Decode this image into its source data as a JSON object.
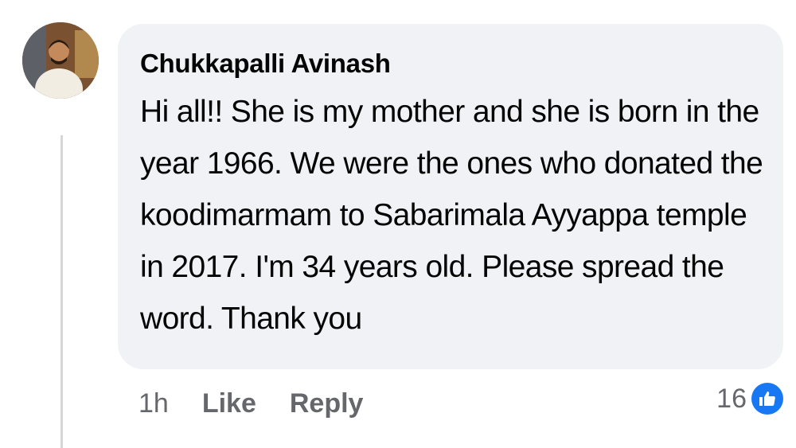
{
  "comment": {
    "author": "Chukkapalli Avinash",
    "text": "Hi all!! She is my mother and she is born in the year 1966. We were the ones who donated the koodimarmam to Sabarimala Ayyappa temple in 2017. I'm 34 years old. Please spread the word. Thank you",
    "timestamp": "1h",
    "like_label": "Like",
    "reply_label": "Reply",
    "reaction_count": "16",
    "reaction_icon": "like-thumb-icon"
  },
  "colors": {
    "bubble_bg": "#f0f2f5",
    "secondary_text": "#65676b",
    "primary_text": "#050505",
    "like_blue": "#1877f2"
  }
}
